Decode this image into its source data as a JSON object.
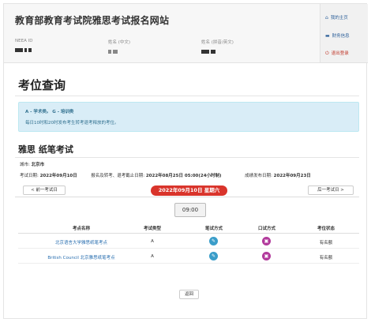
{
  "header": {
    "site_title": "教育部教育考试院雅思考试报名网站",
    "fields": [
      {
        "label": "NEEA ID"
      },
      {
        "label": "姓名 (中文)"
      },
      {
        "label": "姓名 (拼音/英文)"
      }
    ]
  },
  "sidebar": {
    "items": [
      {
        "label": "我的主页",
        "icon": "home-icon"
      },
      {
        "label": "财务信息",
        "icon": "card-icon"
      },
      {
        "label": "退出登录",
        "icon": "power-icon"
      }
    ]
  },
  "page": {
    "title": "考位查询",
    "info_line1_prefix": "A - 学术类。 G - 培训类",
    "info_line2": "每日10时和20时发布考生转考退考释放的考位。",
    "section_title": "雅思 纸笔考试",
    "city_label": "城市:",
    "city_value": "北京市",
    "exam_date_label": "考试日期:",
    "exam_date_value": "2022年09月10日",
    "deadline_label": "报名及转考、退考截止日期:",
    "deadline_value": "2022年08月25日 05:00(24小时制)",
    "result_label": "成绩发布日期:",
    "result_value": "2022年09月23日"
  },
  "nav": {
    "prev_label": "< 前一考试日",
    "next_label": "后一考试日 >",
    "current_date": "2022年09月10日 星期六",
    "time_label": "09:00"
  },
  "table": {
    "headers": [
      "考点名称",
      "考试类型",
      "笔试方式",
      "口试方式",
      "考位状态"
    ],
    "rows": [
      {
        "name": "北京语言大学雅思纸笔考点",
        "type": "A",
        "status": "有名额"
      },
      {
        "name": "British Council 北京雅思纸笔考点",
        "type": "A",
        "status": "有名额"
      }
    ]
  },
  "back_label": "返回",
  "colors": {
    "accent": "#d9342b",
    "link": "#2a6fb0",
    "info_bg": "#d9edf7",
    "written_icon": "#3a9dc9",
    "oral_icon": "#b23a9c"
  }
}
